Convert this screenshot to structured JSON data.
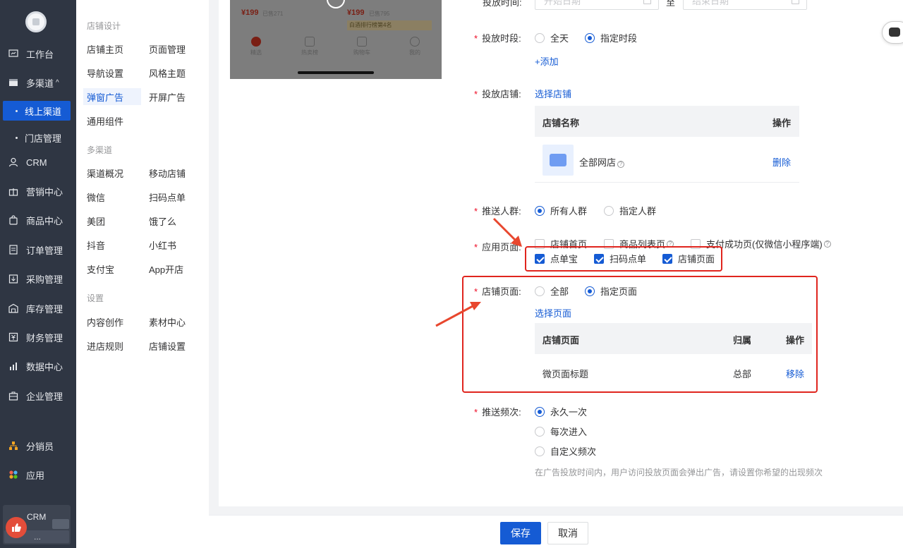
{
  "sidebar": {
    "items": [
      {
        "label": "工作台",
        "icon": "dashboard-icon"
      },
      {
        "label": "多渠道",
        "icon": "store-icon",
        "caret": "^"
      },
      {
        "label": "CRM",
        "icon": "user-icon"
      },
      {
        "label": "营销中心",
        "icon": "gift-icon"
      },
      {
        "label": "商品中心",
        "icon": "bag-icon"
      },
      {
        "label": "订单管理",
        "icon": "order-icon"
      },
      {
        "label": "采购管理",
        "icon": "purchase-icon"
      },
      {
        "label": "库存管理",
        "icon": "warehouse-icon"
      },
      {
        "label": "财务管理",
        "icon": "finance-icon"
      },
      {
        "label": "数据中心",
        "icon": "chart-icon"
      },
      {
        "label": "企业管理",
        "icon": "enterprise-icon"
      },
      {
        "label": "分销员",
        "icon": "distributor-icon"
      },
      {
        "label": "应用",
        "icon": "apps-icon"
      }
    ],
    "subitems": [
      {
        "label": "线上渠道",
        "active": true
      },
      {
        "label": "门店管理",
        "active": false
      }
    ],
    "bottom": {
      "label": "CRM",
      "more": "..."
    }
  },
  "subnav": {
    "groups": [
      {
        "title": "店铺设计",
        "links": [
          "店铺主页",
          "页面管理",
          "导航设置",
          "风格主题",
          "弹窗广告",
          "开屏广告",
          "通用组件"
        ]
      },
      {
        "title": "多渠道",
        "links": [
          "渠道概况",
          "移动店铺",
          "微信",
          "扫码点单",
          "美团",
          "饿了么",
          "抖音",
          "小红书",
          "支付宝",
          "App开店"
        ]
      },
      {
        "title": "设置",
        "links": [
          "内容创作",
          "素材中心",
          "进店规则",
          "店铺设置"
        ]
      }
    ],
    "active": "弹窗广告"
  },
  "preview": {
    "price1": "¥199",
    "sold1": "已售271",
    "price2": "¥199",
    "sold2": "已售795",
    "rank": "白酒排行榜第4名",
    "tabs": [
      "精选",
      "热卖榜",
      "购物车",
      "我的"
    ]
  },
  "form": {
    "time_label": "投放时间:",
    "date_start": "开始日期",
    "date_sep": "至",
    "date_end": "结束日期",
    "period_label": "投放时段:",
    "period_options": [
      "全天",
      "指定时段"
    ],
    "add_label": "+添加",
    "store_label": "投放店铺:",
    "select_store": "选择店铺",
    "store_table": {
      "col_name": "店铺名称",
      "col_op": "操作",
      "row_name": "全部网店",
      "row_op": "删除"
    },
    "crowd_label": "推送人群:",
    "crowd_options": [
      "所有人群",
      "指定人群"
    ],
    "page_label": "应用页面:",
    "page_options": [
      "店铺首页",
      "商品列表页",
      "支付成功页(仅微信小程序端)",
      "点单宝",
      "扫码点单",
      "店铺页面"
    ],
    "shop_page_label": "店铺页面:",
    "shop_page_options": [
      "全部",
      "指定页面"
    ],
    "select_page": "选择页面",
    "page_table": {
      "col_page": "店铺页面",
      "col_owner": "归属",
      "col_op": "操作",
      "row_page": "微页面标题",
      "row_owner": "总部",
      "row_op": "移除"
    },
    "freq_label": "推送频次:",
    "freq_options": [
      "永久一次",
      "每次进入",
      "自定义频次"
    ],
    "freq_hint": "在广告投放时间内，用户访问投放页面会弹出广告，请设置你希望的出现频次"
  },
  "footer": {
    "save": "保存",
    "cancel": "取消"
  },
  "colors": {
    "primary": "#155bd4",
    "sidebar": "#2f3643",
    "annotation": "#e0251e"
  }
}
